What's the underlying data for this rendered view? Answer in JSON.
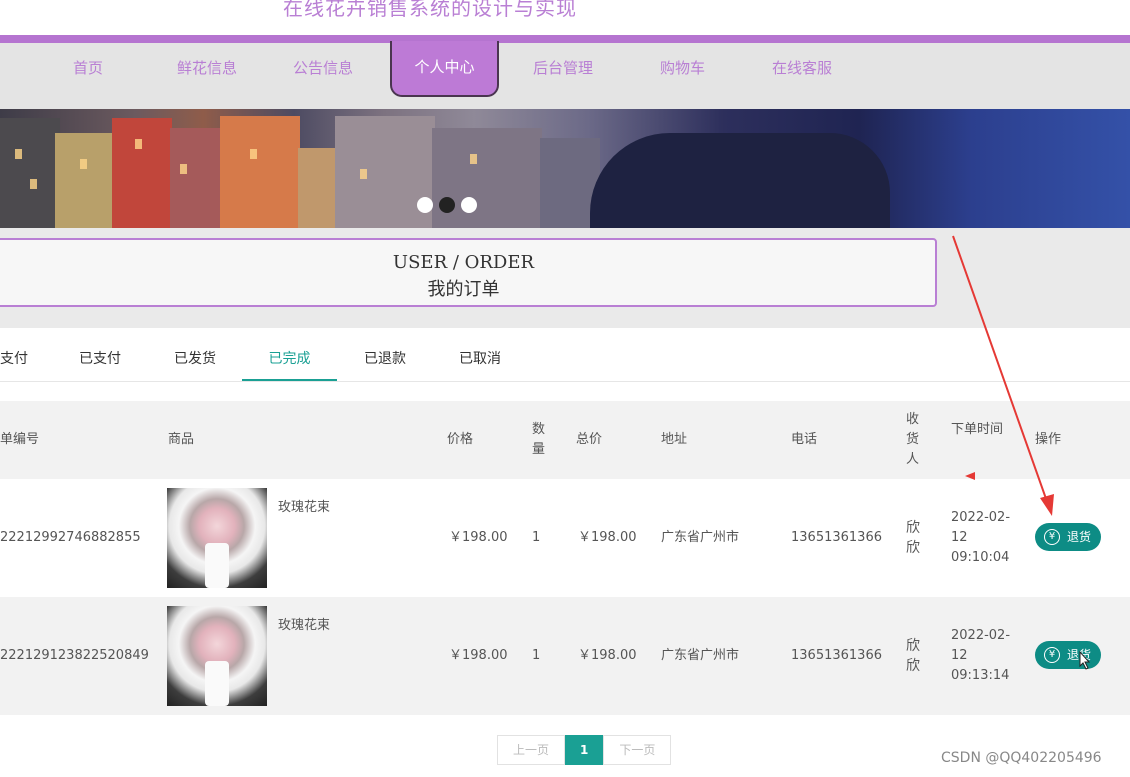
{
  "site_title": "在线花卉销售系统的设计与实现",
  "nav": {
    "items": [
      "首页",
      "鲜花信息",
      "公告信息",
      "个人中心",
      "后台管理",
      "购物车",
      "在线客服"
    ],
    "active_index": 3
  },
  "order_header": {
    "en": "USER / ORDER",
    "cn": "我的订单"
  },
  "tabs": {
    "items": [
      "支付",
      "已支付",
      "已发货",
      "已完成",
      "已退款",
      "已取消"
    ],
    "active_index": 3
  },
  "table": {
    "headers": {
      "order_no": "单编号",
      "product": "商品",
      "price": "价格",
      "qty": "数量",
      "total": "总价",
      "address": "地址",
      "phone": "电话",
      "receiver": "收货人",
      "order_time": "下单时间",
      "action": "操作"
    },
    "rows": [
      {
        "order_no": "22212992746882855",
        "product": "玫瑰花束",
        "price": "￥198.00",
        "qty": "1",
        "total": "￥198.00",
        "address": "广东省广州市",
        "phone": "13651361366",
        "receiver": "欣欣",
        "date": "2022-02-12",
        "time": "09:10:04",
        "action_label": "退货"
      },
      {
        "order_no": "222129123822520849",
        "product": "玫瑰花束",
        "price": "￥198.00",
        "qty": "1",
        "total": "￥198.00",
        "address": "广东省广州市",
        "phone": "13651361366",
        "receiver": "欣欣",
        "date": "2022-02-12",
        "time": "09:13:14",
        "action_label": "退货"
      }
    ]
  },
  "pagination": {
    "prev": "上一页",
    "current": "1",
    "next": "下一页"
  },
  "watermark": "CSDN @QQ402205496",
  "colors": {
    "accent_purple": "#b97fd4",
    "teal": "#1aa094",
    "refund_button": "#0d8c85",
    "arrow": "#e53935"
  }
}
